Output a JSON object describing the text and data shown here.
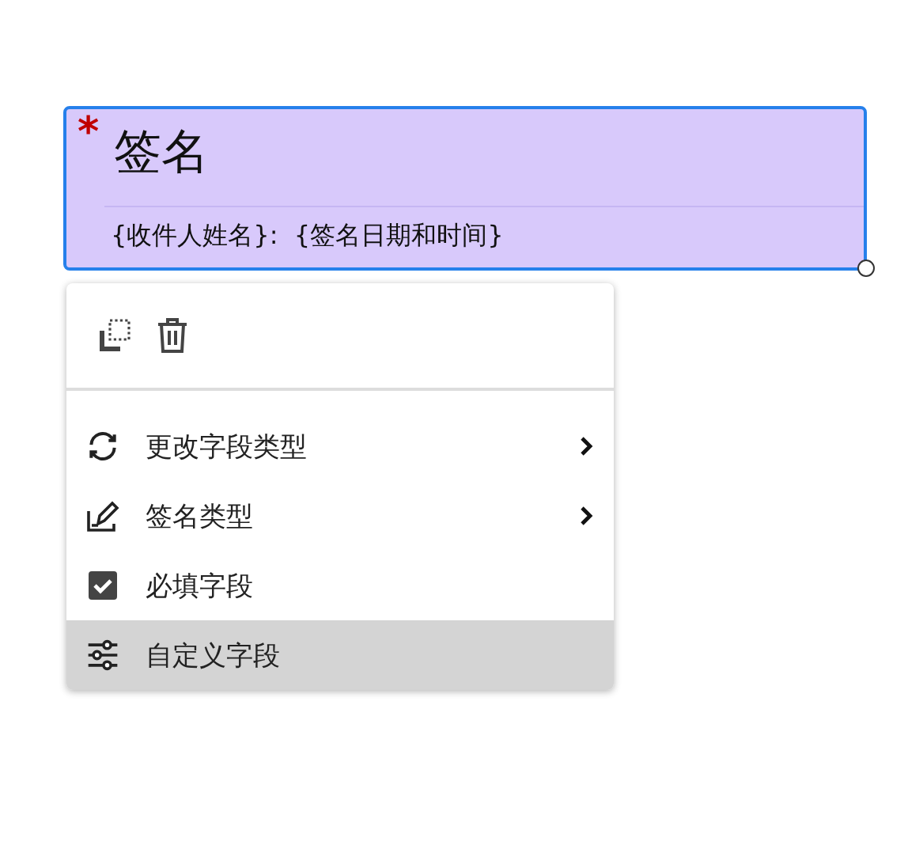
{
  "field": {
    "required_mark": "*",
    "title": "签名",
    "subtitle": "{收件人姓名}:  {签名日期和时间}",
    "selected": true
  },
  "menu": {
    "items": [
      {
        "kind": "refresh",
        "label": "更改字段类型",
        "submenu": true,
        "selected": false
      },
      {
        "kind": "pen",
        "label": "签名类型",
        "submenu": true,
        "selected": false
      },
      {
        "kind": "checkbox",
        "label": "必填字段",
        "checked": true,
        "submenu": false,
        "selected": false
      },
      {
        "kind": "sliders",
        "label": "自定义字段",
        "submenu": false,
        "selected": true
      }
    ]
  }
}
